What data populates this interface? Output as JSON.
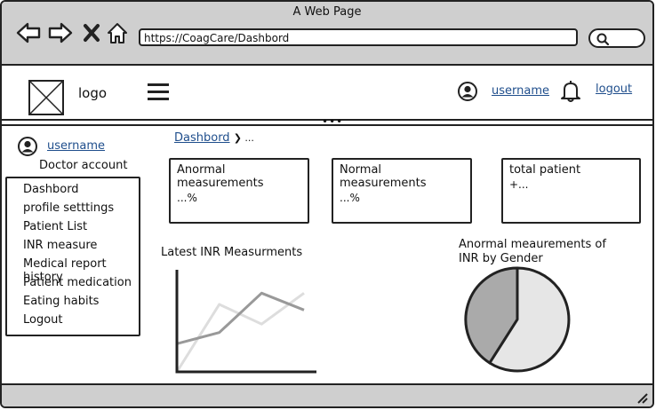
{
  "window": {
    "title": "A Web Page",
    "url": "https://CoagCare/Dashbord"
  },
  "header": {
    "logo_text": "logo",
    "username": "username",
    "logout": "logout"
  },
  "sidebar": {
    "username": "username",
    "account_type": "Doctor account",
    "items": [
      {
        "label": "Dashbord"
      },
      {
        "label": "profile setttings"
      },
      {
        "label": "Patient List"
      },
      {
        "label": "INR measure"
      },
      {
        "label": "Medical report history"
      },
      {
        "label": "Patient medication"
      },
      {
        "label": "Eating habits"
      },
      {
        "label": "Logout"
      }
    ]
  },
  "breadcrumb": {
    "current": "Dashbord",
    "next": "..."
  },
  "cards": [
    {
      "title": "Anormal measurements",
      "value": "...%"
    },
    {
      "title": "Normal measurements",
      "value": "...%"
    },
    {
      "title": "total patient",
      "value": "+..."
    }
  ],
  "line_chart": {
    "title": "Latest INR Measurments"
  },
  "pie_chart": {
    "title_line1": "Anormal meaurements of",
    "title_line2": "INR by Gender"
  },
  "chart_data": [
    {
      "type": "line",
      "title": "Latest INR Measurments",
      "xlabel": "",
      "ylabel": "",
      "x": [
        0,
        1,
        2,
        3
      ],
      "series": [
        {
          "values": [
            1.0,
            1.4,
            2.8,
            2.2
          ],
          "color": "#999999"
        },
        {
          "values": [
            0.0,
            2.4,
            1.7,
            2.8
          ],
          "color": "#dddddd"
        }
      ],
      "ylim": [
        0,
        3.6
      ]
    },
    {
      "type": "pie",
      "title": "Anormal meaurements of INR by Gender",
      "values": [
        41,
        59
      ],
      "colors": [
        "#aaaaaa",
        "#e6e6e6"
      ]
    }
  ]
}
